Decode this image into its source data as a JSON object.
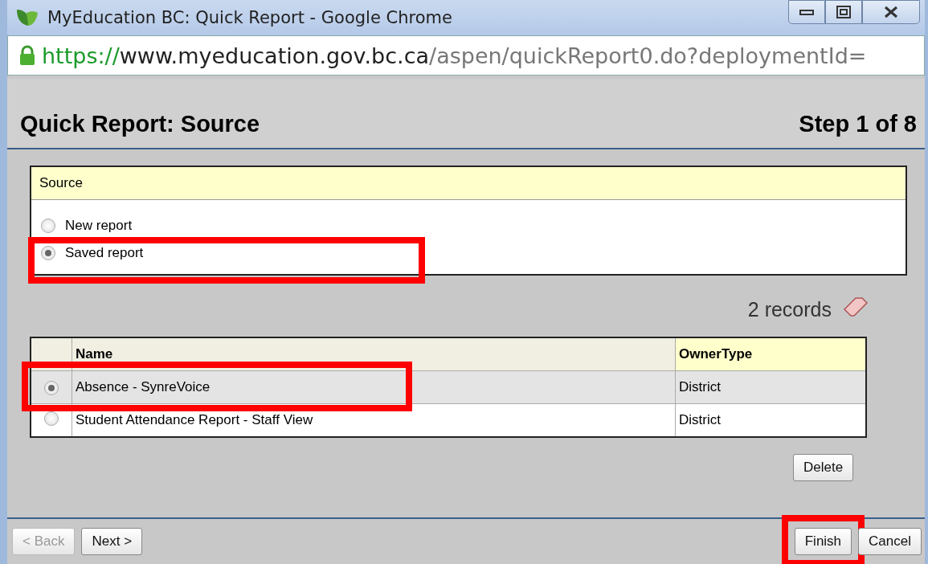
{
  "window": {
    "title": "MyEducation BC: Quick Report - Google Chrome"
  },
  "address_bar": {
    "scheme": "https://",
    "host": "www.myeducation.gov.bc.ca",
    "path": "/aspen/quickReport0.do?deploymentId="
  },
  "header": {
    "title": "Quick Report: Source",
    "step": "Step 1 of 8"
  },
  "source": {
    "heading": "Source",
    "options": [
      {
        "label": "New report",
        "selected": false,
        "highlighted": false
      },
      {
        "label": "Saved report",
        "selected": true,
        "highlighted": true
      }
    ]
  },
  "records": {
    "count": "2 records"
  },
  "table": {
    "columns": [
      "Name",
      "OwnerType"
    ],
    "rows": [
      {
        "name": "Absence - SynreVoice",
        "owner_type": "District",
        "selected": true,
        "highlighted": true
      },
      {
        "name": "Student Attendance Report - Staff View",
        "owner_type": "District",
        "selected": false,
        "highlighted": false
      }
    ]
  },
  "delete_button": "Delete",
  "footer": {
    "buttons": [
      {
        "label": "< Back",
        "disabled": true,
        "highlighted": false
      },
      {
        "label": "Next >",
        "disabled": false,
        "highlighted": false
      },
      {
        "label": "Finish",
        "disabled": false,
        "highlighted": true
      },
      {
        "label": "Cancel",
        "disabled": false,
        "highlighted": false
      }
    ]
  }
}
